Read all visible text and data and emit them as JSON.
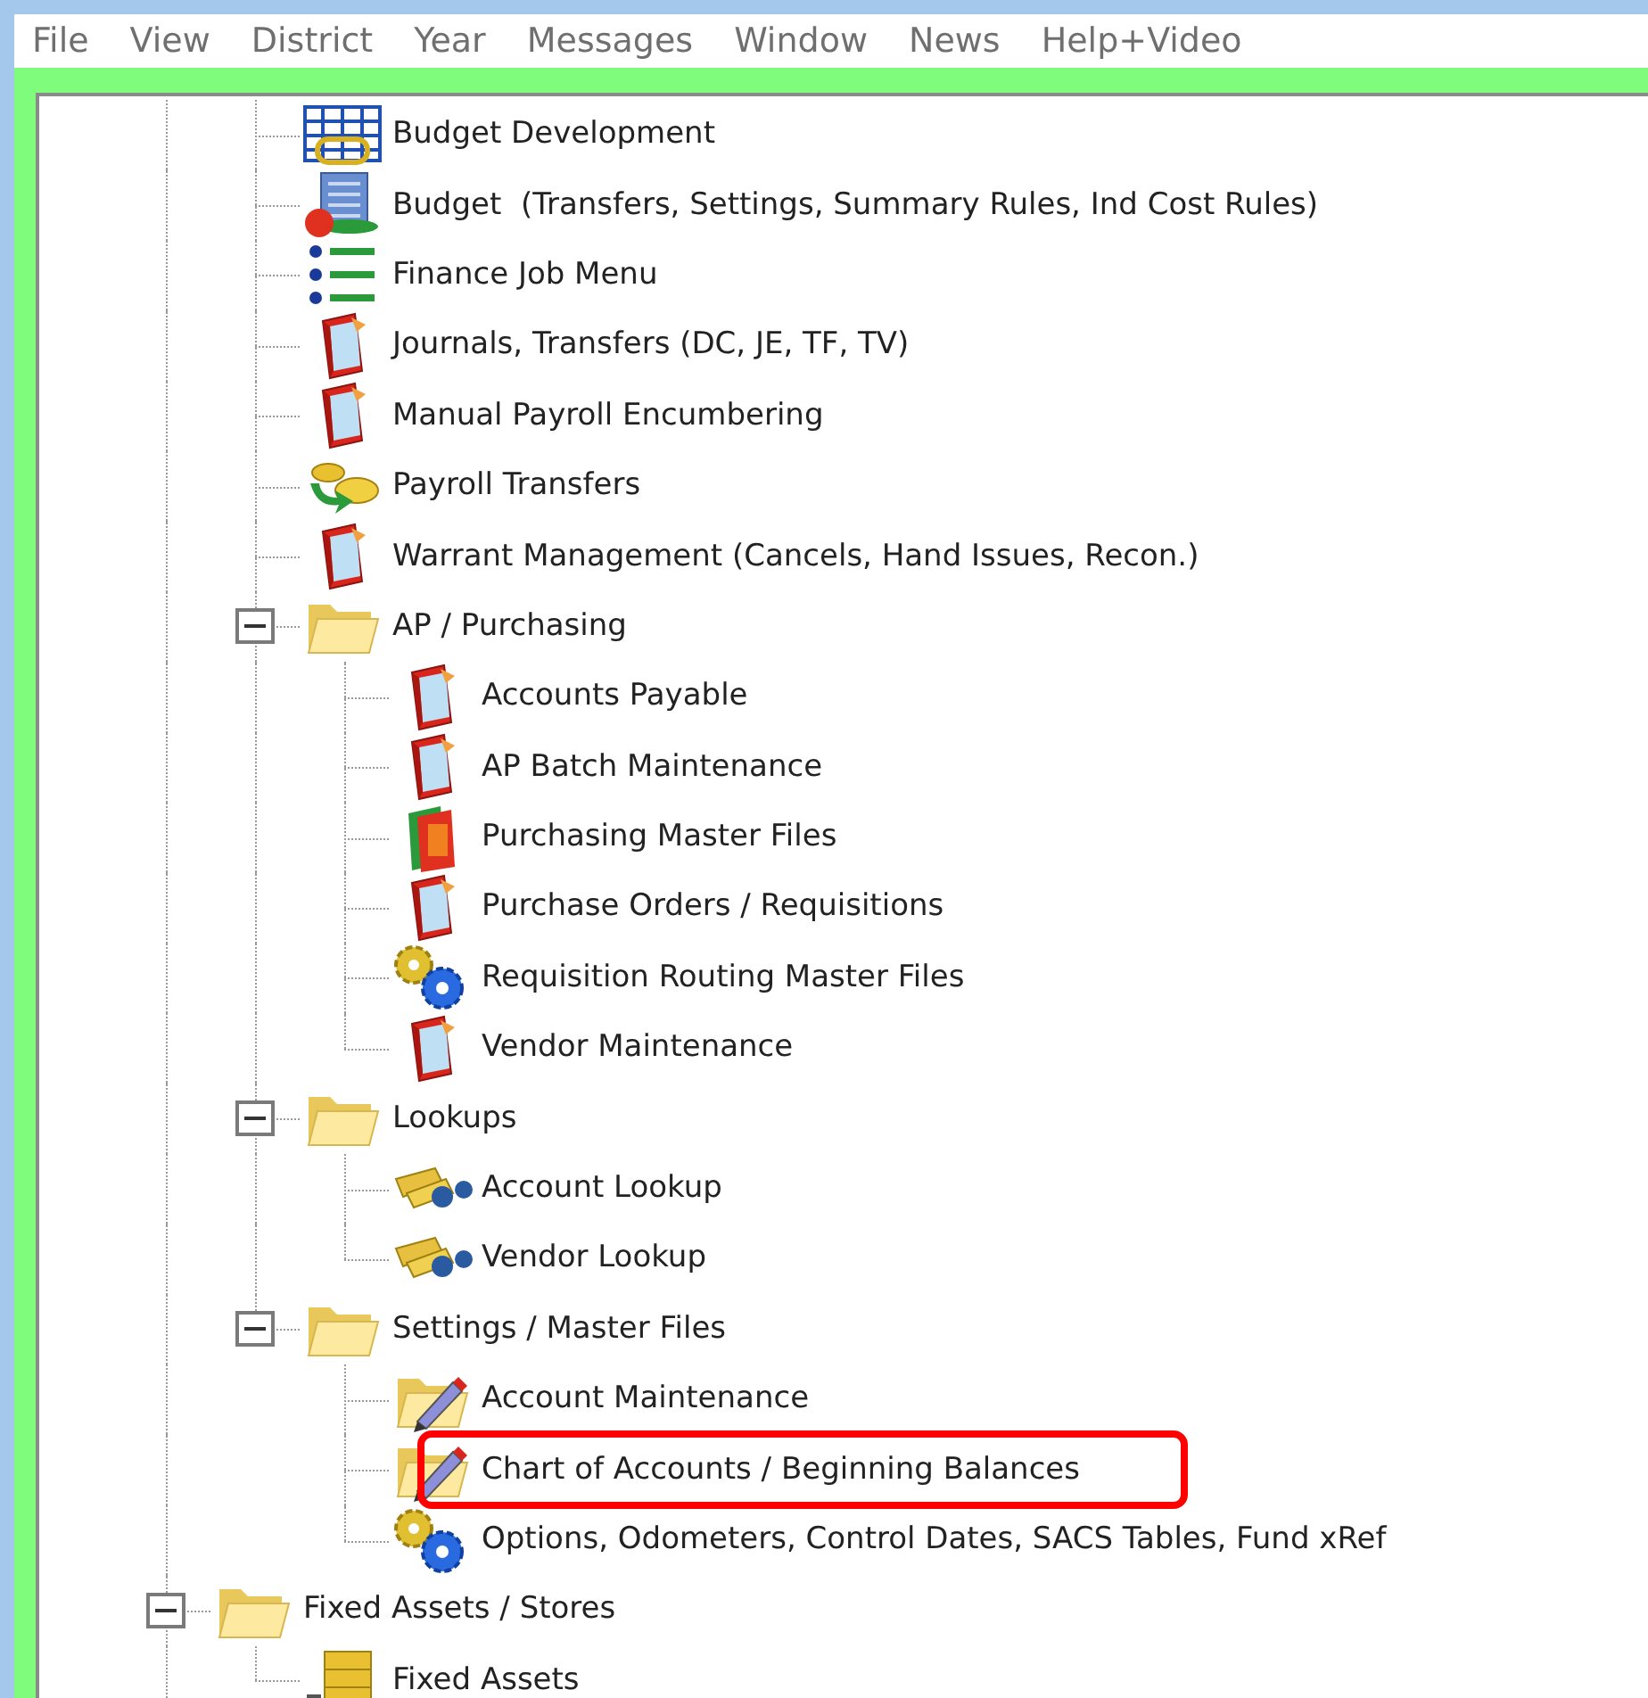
{
  "menu": [
    "File",
    "View",
    "District",
    "Year",
    "Messages",
    "Window",
    "News",
    "Help+Video"
  ],
  "tree": [
    {
      "children": [
        {
          "label": "Budget Development",
          "kind": "grid"
        },
        {
          "label": "Budget  (Transfers, Settings, Summary Rules, Ind Cost Rules)",
          "kind": "building"
        },
        {
          "label": "Finance Job Menu",
          "kind": "list"
        },
        {
          "label": "Journals, Transfers (DC, JE, TF, TV)",
          "kind": "book"
        },
        {
          "label": "Manual Payroll Encumbering",
          "kind": "book"
        },
        {
          "label": "Payroll Transfers",
          "kind": "coins"
        },
        {
          "label": "Warrant Management (Cancels, Hand Issues, Recon.)",
          "kind": "book"
        },
        {
          "label": "AP / Purchasing",
          "kind": "folder",
          "expanded": true,
          "children": [
            {
              "label": "Accounts Payable",
              "kind": "book"
            },
            {
              "label": "AP Batch Maintenance",
              "kind": "book"
            },
            {
              "label": "Purchasing Master Files",
              "kind": "money-book"
            },
            {
              "label": "Purchase Orders / Requisitions",
              "kind": "book"
            },
            {
              "label": "Requisition Routing Master Files",
              "kind": "gears"
            },
            {
              "label": "Vendor Maintenance",
              "kind": "book"
            }
          ]
        },
        {
          "label": "Lookups",
          "kind": "folder",
          "expanded": true,
          "children": [
            {
              "label": "Account Lookup",
              "kind": "binoculars"
            },
            {
              "label": "Vendor Lookup",
              "kind": "binoculars"
            }
          ]
        },
        {
          "label": "Settings / Master Files",
          "kind": "folder",
          "expanded": true,
          "children": [
            {
              "label": "Account Maintenance",
              "kind": "folder-pencil",
              "highlighted": false
            },
            {
              "label": "Chart of Accounts / Beginning Balances",
              "kind": "folder-pencil",
              "highlighted": true
            },
            {
              "label": "Options, Odometers, Control Dates, SACS Tables, Fund xRef",
              "kind": "gears",
              "highlighted": false
            }
          ]
        }
      ]
    },
    {
      "label": "Fixed Assets / Stores",
      "kind": "folder",
      "expanded": true,
      "children": [
        {
          "label": "Fixed Assets",
          "kind": "cabinet"
        }
      ]
    }
  ]
}
